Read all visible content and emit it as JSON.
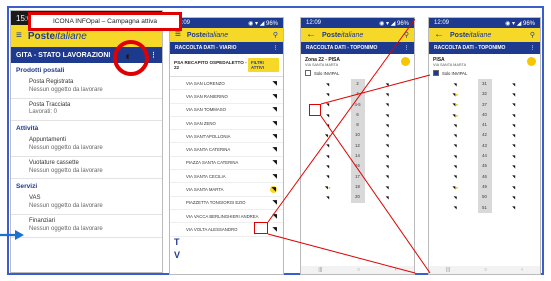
{
  "callout": {
    "text": "ICONA INFOpal – Campagna attiva"
  },
  "phone1": {
    "status": {
      "time": "15:03",
      "icons": "◉ ▲ ▮"
    },
    "brand": {
      "bold": "Poste",
      "italic": "italiane"
    },
    "title": "GITA - STATO LAVORAZIONI",
    "sections": [
      {
        "label": "Prodotti postali",
        "items": [
          {
            "title": "Posta Registrata",
            "sub": "Nessun oggetto da lavorare"
          },
          {
            "title": "Posta Tracciata",
            "sub": "Lavorati: 0"
          }
        ]
      },
      {
        "label": "Attività",
        "items": [
          {
            "title": "Appuntamenti",
            "sub": "Nessun oggetto da lavorare"
          },
          {
            "title": "Vuotature cassette",
            "sub": "Nessun oggetto da lavorare"
          }
        ]
      },
      {
        "label": "Servizi",
        "items": [
          {
            "title": "VAS",
            "sub": "Nessun oggetto da lavorare"
          },
          {
            "title": "Finanziari",
            "sub": "Nessun oggetto da lavorare"
          }
        ]
      }
    ]
  },
  "phone2": {
    "status": {
      "time": "12:09",
      "icons": "◉ ▾ ◢ 96%"
    },
    "brand": {
      "bold": "Poste",
      "italic": "italiane"
    },
    "title": "RACCOLTA DATI - VIARIO",
    "head_label": "PSA RECAPITO OSPEDALETTO - 22",
    "head_button": "FILTRI ATTIVI",
    "streets": [
      "VIA SAN LORENZO",
      "VIA SAN RANIERINO",
      "VIA SAN TOMMASO",
      "VIA SAN ZENO",
      "VIA SANT'APOLLONIA",
      "VIA SANTA CATERINA",
      "PIAZZA SANTA CATERINA",
      "VIA SANTA CECILIA",
      "VIA SANTA MARTA",
      "PIAZZETTA TONGIORGI EZIO",
      "VIA VACCA BERLINGHIERI ANDREA",
      "VIA VOLTA ALESSANDRO"
    ],
    "letters": [
      "T",
      "V"
    ]
  },
  "phone3": {
    "status": {
      "time": "12:09",
      "icons": "◉ ▾ ◢ 96%"
    },
    "brand": {
      "bold": "Poste",
      "italic": "italiane"
    },
    "title": "RACCOLTA DATI - TOPONIMO",
    "zone_title": "Zona 22 - PISA",
    "zone_sub": "VIA SANTA MARTA",
    "checkbox_label": "Solo INVIPAL",
    "rows": [
      "2",
      "4",
      "4-5",
      "6",
      "8",
      "10",
      "12",
      "14",
      "16",
      "17",
      "18",
      "20"
    ]
  },
  "phone4": {
    "status": {
      "time": "12:09",
      "icons": "◉ ▾ ◢ 96%"
    },
    "brand": {
      "bold": "Poste",
      "italic": "italiane"
    },
    "title": "RACCOLTA DATI - TOPONIMO",
    "zone_title": "PISA",
    "zone_sub": "VIA SANTA MARTA",
    "checkbox_label": "Solo INVIPAL",
    "rows": [
      "31",
      "32",
      "37",
      "40",
      "41",
      "42",
      "43",
      "44",
      "45",
      "46",
      "49",
      "50",
      "51"
    ]
  },
  "colors": {
    "yellow": "#f6d928",
    "blue": "#1d3a8f",
    "red": "#e00000"
  },
  "icons": [
    "hamburger-icon",
    "location-pin-icon",
    "more-vert-icon",
    "mailbox-icon",
    "campaign-icon",
    "back-arrow-icon"
  ]
}
